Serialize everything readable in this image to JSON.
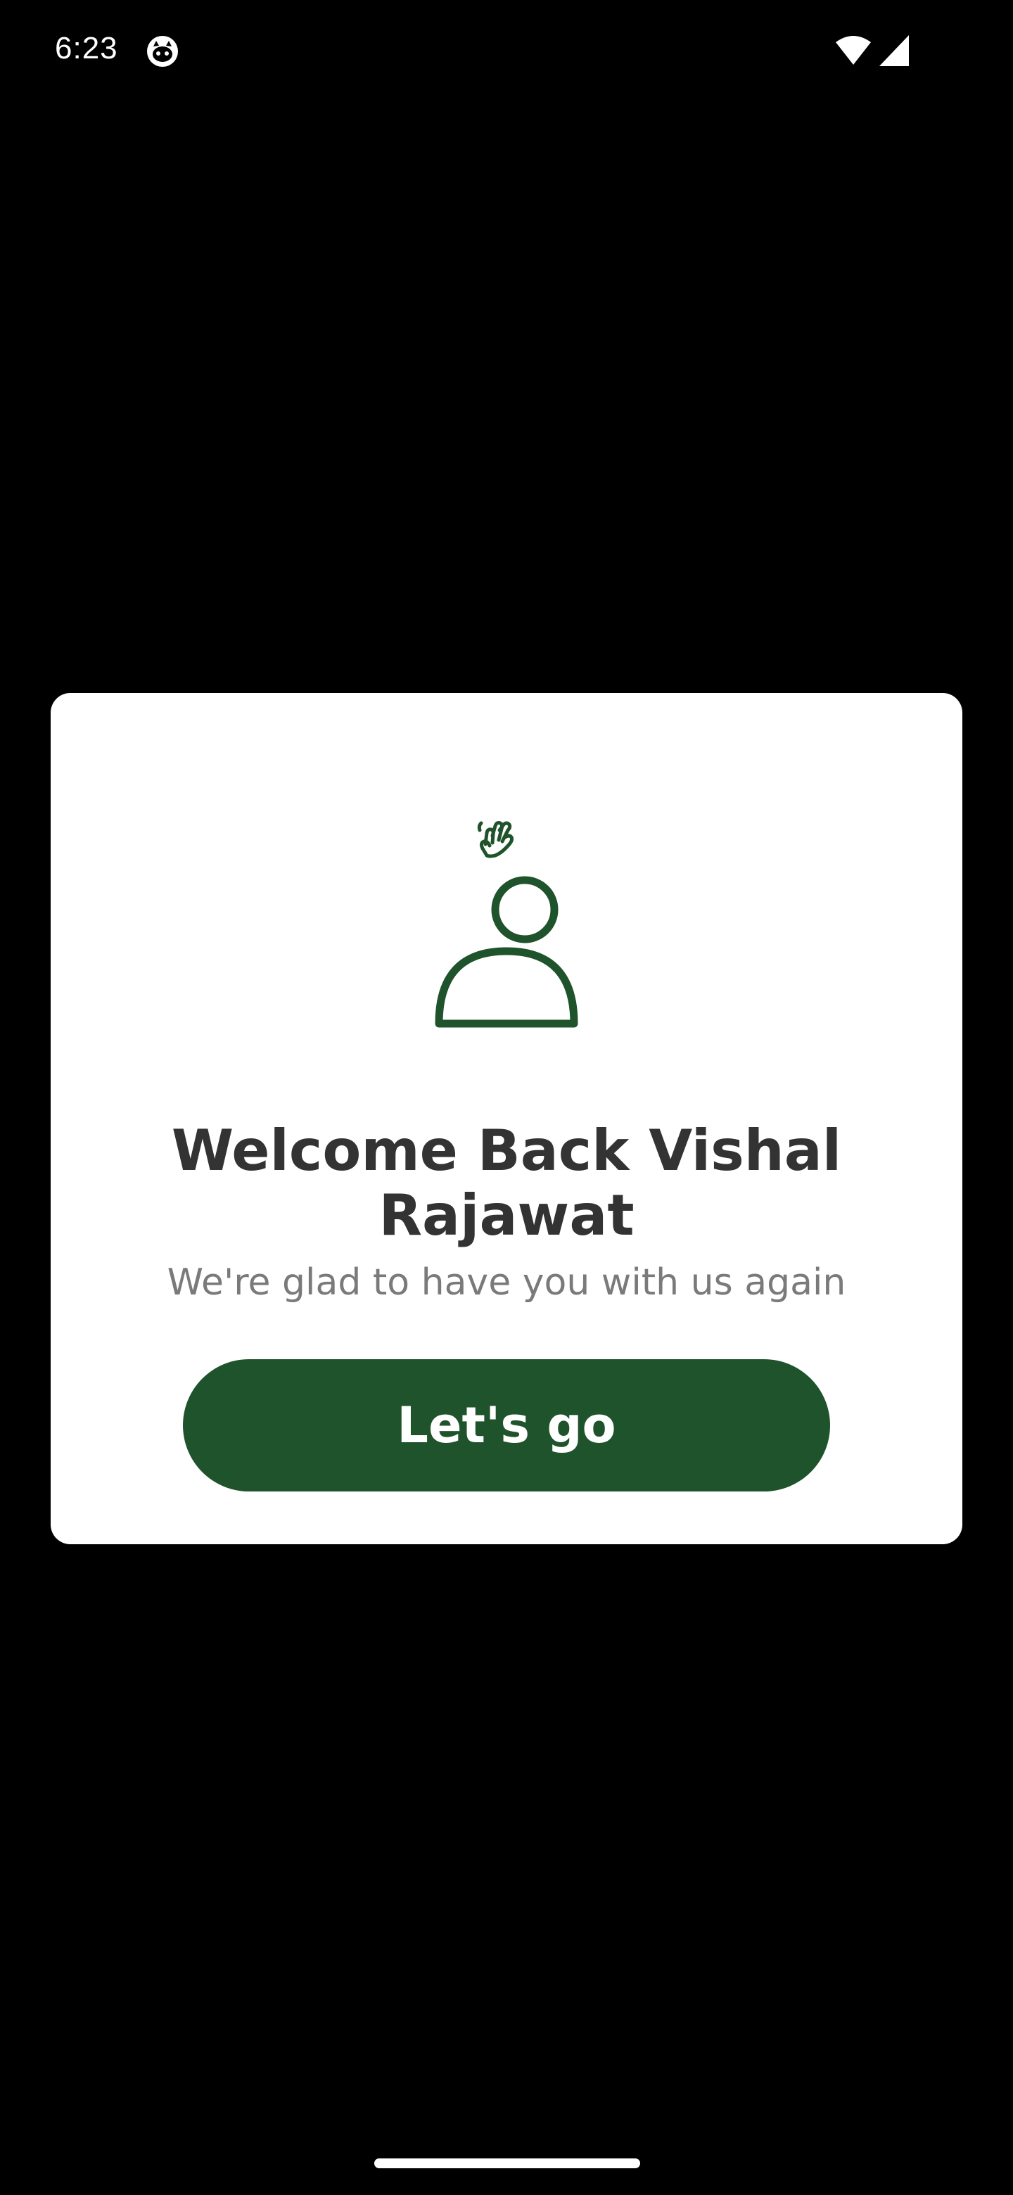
{
  "status_bar": {
    "time": "6:23",
    "icons": [
      "app-notification-icon",
      "wifi-icon",
      "cellular-signal-icon"
    ]
  },
  "dialog": {
    "illustration_icon": "waving-user-icon",
    "title": "Welcome Back Vishal Rajawat",
    "subtitle": "We're glad to have you with us again",
    "button_label": "Let's go"
  },
  "colors": {
    "accent": "#1f532b",
    "title": "#333333",
    "subtitle": "#7a7a7a",
    "background": "#000000",
    "dialog_background": "#ffffff"
  }
}
